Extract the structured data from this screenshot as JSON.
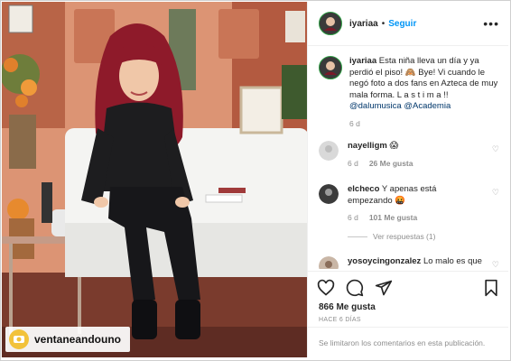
{
  "post": {
    "username": "iyariaa",
    "separator": "•",
    "follow_label": "Seguir",
    "more_label": "•••",
    "caption_pre": "Esta niña lleva un día y ya perdió el piso! 🙈 Bye! Vi cuando le negó foto a dos fans en Azteca de muy mala forma. L a s t i m a !! ",
    "mention_1": "@dalumusica",
    "mention_2": "@Academia",
    "caption_age": "6 d",
    "likes": "866 Me gusta",
    "time_ago": "HACE 6 DÍAS",
    "comments_limited": "Se limitaron los comentarios en esta publicación."
  },
  "comments": [
    {
      "username": "nayelligm",
      "text": "😱",
      "age": "6 d",
      "likes": "26 Me gusta"
    },
    {
      "username": "elcheco",
      "text": "Y apenas está empezando 🤬",
      "age": "6 d",
      "likes": "101 Me gusta",
      "replies": "Ver respuestas (1)"
    },
    {
      "username": "yosoycingonzalez",
      "text": "Lo malo es que"
    }
  ],
  "watermark": {
    "label": "ventaneandouno"
  },
  "icons": {
    "heart": "heart-icon",
    "comment": "comment-icon",
    "share": "share-icon",
    "save": "bookmark-icon"
  },
  "colors": {
    "follow": "#0095f6",
    "hair": "#8e1a2a",
    "wall": "#e08f6a"
  }
}
